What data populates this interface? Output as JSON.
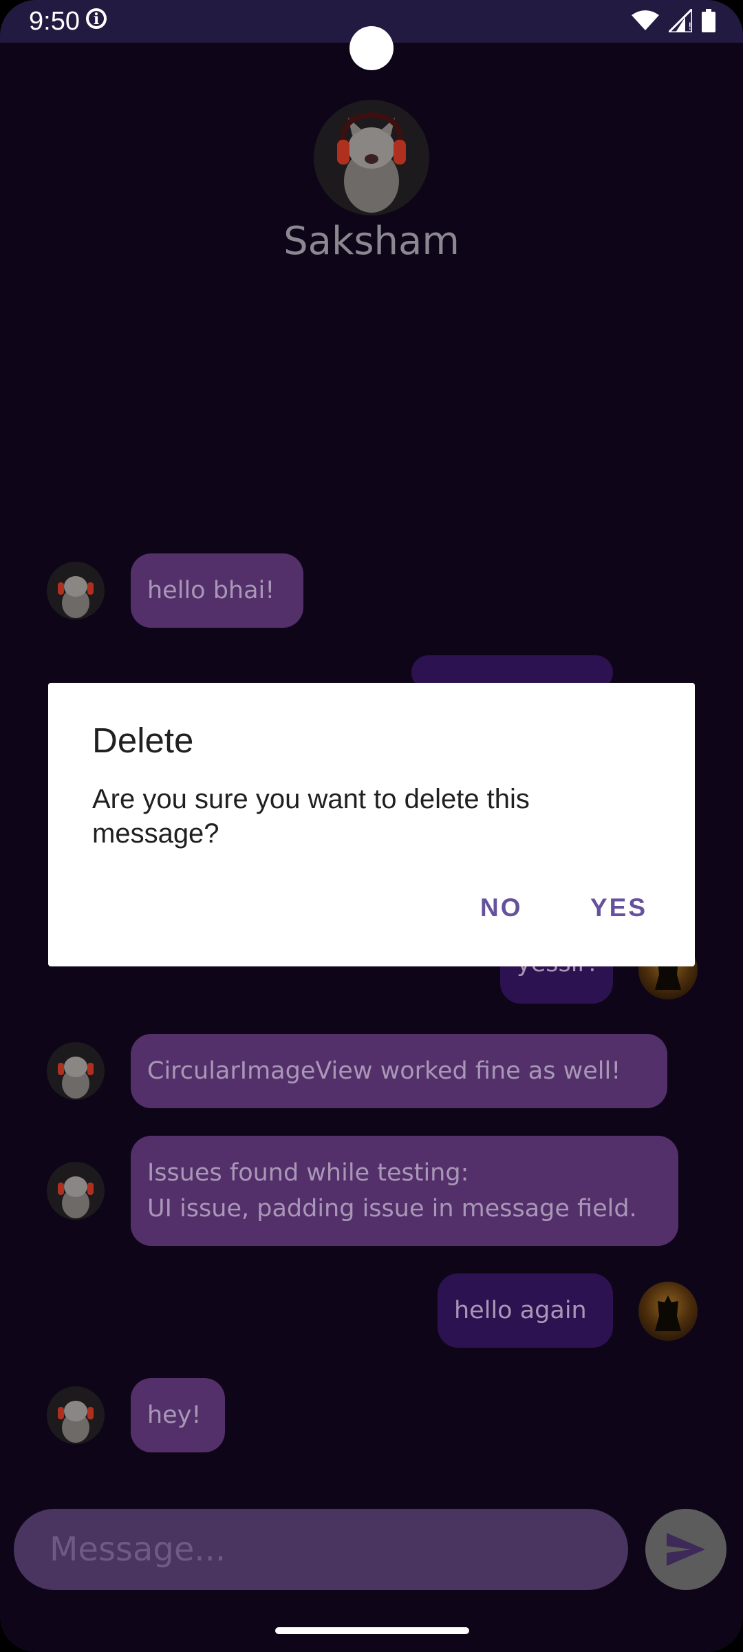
{
  "status_bar": {
    "time": "9:50"
  },
  "chat_header": {
    "contact_name": "Saksham"
  },
  "messages": [
    {
      "direction": "received",
      "text": "hello bhai!"
    },
    {
      "direction": "sent",
      "text": "yessir!"
    },
    {
      "direction": "received",
      "text": "CircularImageView worked fine as well!"
    },
    {
      "direction": "received",
      "text": "Issues found while testing:\nUI issue, padding issue in message field."
    },
    {
      "direction": "sent",
      "text": "hello again"
    },
    {
      "direction": "received",
      "text": "hey!"
    }
  ],
  "composer": {
    "placeholder": "Message..."
  },
  "dialog": {
    "title": "Delete",
    "message": "Are you sure you want to delete this message?",
    "no_label": "NO",
    "yes_label": "YES"
  },
  "colors": {
    "background": "#0e0618",
    "status_bar": "#221a40",
    "received_bubble": "#54306b",
    "sent_bubble": "#2c1250",
    "dialog_button": "#66519c"
  },
  "icons": [
    "info-icon",
    "wifi-icon",
    "cellular-signal-icon",
    "battery-icon",
    "send-icon"
  ]
}
